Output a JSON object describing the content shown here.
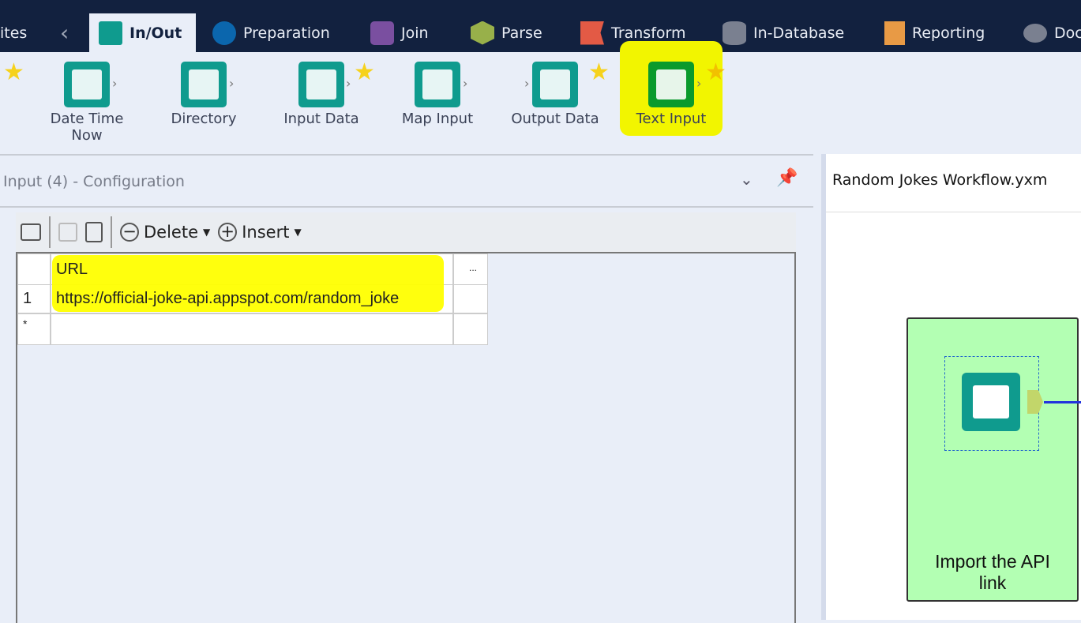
{
  "tabs": [
    {
      "label": "ites",
      "icon": "none"
    },
    {
      "label": "In/Out",
      "icon": "folder-icon",
      "color": "#0f9b8e",
      "active": true
    },
    {
      "label": "Preparation",
      "icon": "circle-icon",
      "color": "#0b66ad"
    },
    {
      "label": "Join",
      "icon": "square-icon",
      "color": "#7a4fa0"
    },
    {
      "label": "Parse",
      "icon": "hexagon-icon",
      "color": "#98b04a"
    },
    {
      "label": "Transform",
      "icon": "flag-icon",
      "color": "#e35a45"
    },
    {
      "label": "In-Database",
      "icon": "database-icon",
      "color": "#7a8090"
    },
    {
      "label": "Reporting",
      "icon": "document-icon",
      "color": "#e89a45"
    },
    {
      "label": "Doc",
      "icon": "comment-icon",
      "color": "#7a8090"
    }
  ],
  "tools": [
    {
      "label": "Date Time Now",
      "icon": "calendar-clock-icon"
    },
    {
      "label": "Directory",
      "icon": "directory-icon"
    },
    {
      "label": "Input Data",
      "icon": "book-icon"
    },
    {
      "label": "Map Input",
      "icon": "globe-icon"
    },
    {
      "label": "Output Data",
      "icon": "output-icon"
    },
    {
      "label": "Text Input",
      "icon": "text-input-icon"
    }
  ],
  "config": {
    "title": "Input (4) - Configuration",
    "delete_label": "Delete",
    "insert_label": "Insert",
    "grid": {
      "header": "URL",
      "more": "...",
      "rows": [
        {
          "num": "1",
          "value": "https://official-joke-api.appspot.com/random_joke"
        }
      ],
      "new_row_marker": "*"
    }
  },
  "canvas": {
    "title": "Random Jokes Workflow.yxm",
    "container_label": "Import the API link",
    "container_color": "#b3ffb3"
  }
}
